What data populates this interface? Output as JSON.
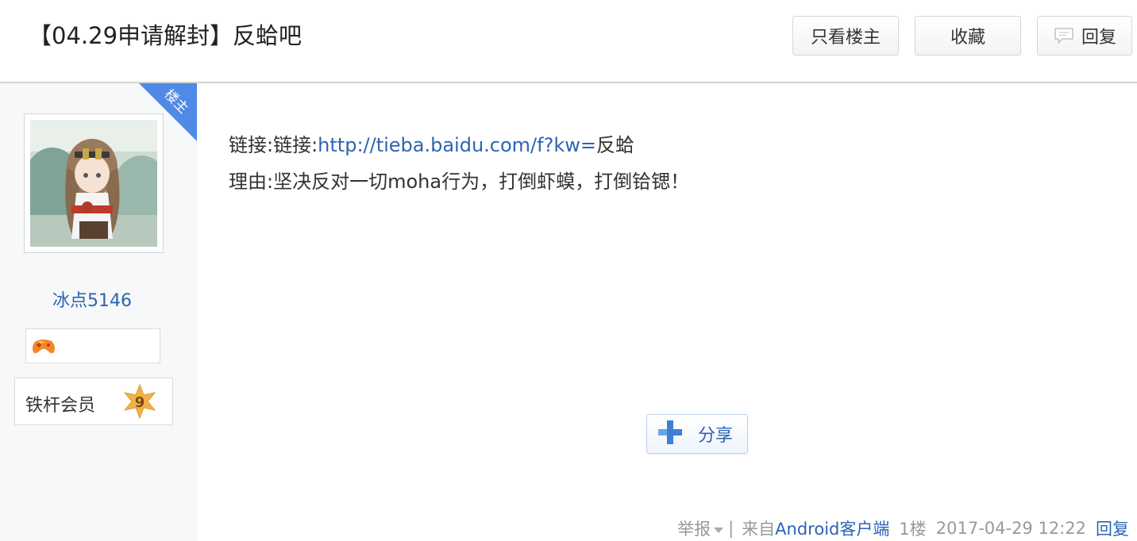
{
  "header": {
    "title": "【04.29申请解封】反蛤吧",
    "buttons": {
      "only_op": "只看楼主",
      "favorite": "收藏",
      "reply": "回复"
    }
  },
  "author": {
    "corner_badge": "楼主",
    "name": "冰点5146",
    "member_label": "铁杆会员",
    "level": "9"
  },
  "post": {
    "line1_prefix": "链接:链接:",
    "line1_link": "http://tieba.baidu.com/f?kw=",
    "line1_suffix": "反蛤",
    "line2": "理由:坚决反对一切moha行为，打倒虾蟆，打倒铪锶！",
    "share_label": "分享"
  },
  "tail": {
    "report": "举报",
    "separator": "|",
    "from_prefix": "来自",
    "client": "Android客户端",
    "floor": "1楼",
    "time": "2017-04-29 12:22",
    "reply": "回复"
  },
  "colors": {
    "link": "#2d64b3",
    "corner_badge": "#4e8ae6",
    "level_star": "#f0b34a"
  }
}
